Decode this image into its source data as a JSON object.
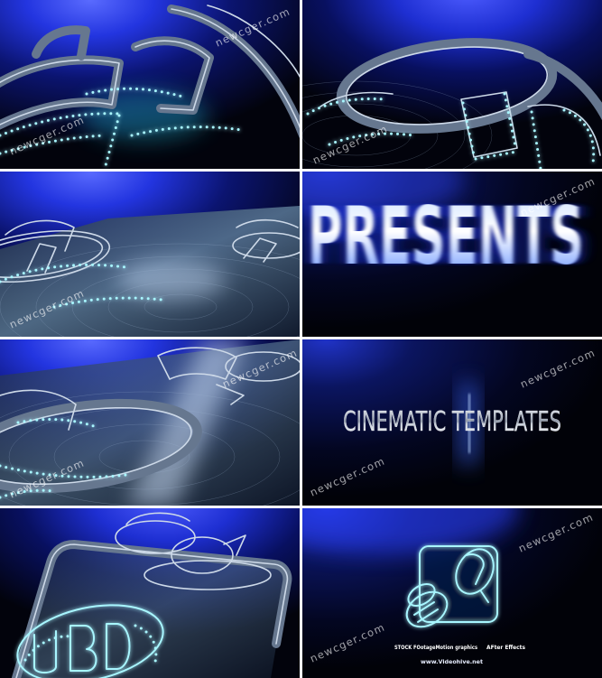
{
  "watermark": "newcger.com",
  "frames": {
    "presents": {
      "title": "PRESENTS"
    },
    "cinematic": {
      "title": "CINEMATIC TEMPLATES"
    },
    "outro": {
      "caption_left": "STOCK FOotageMotion graphics",
      "caption_right": "AFter Effects",
      "url": "www.Videohive.net"
    }
  },
  "colors": {
    "divider": "#ffffff",
    "neon_cyan": "#a8f6ff",
    "deep_blue": "#1f30d6",
    "background": "#02030c"
  }
}
